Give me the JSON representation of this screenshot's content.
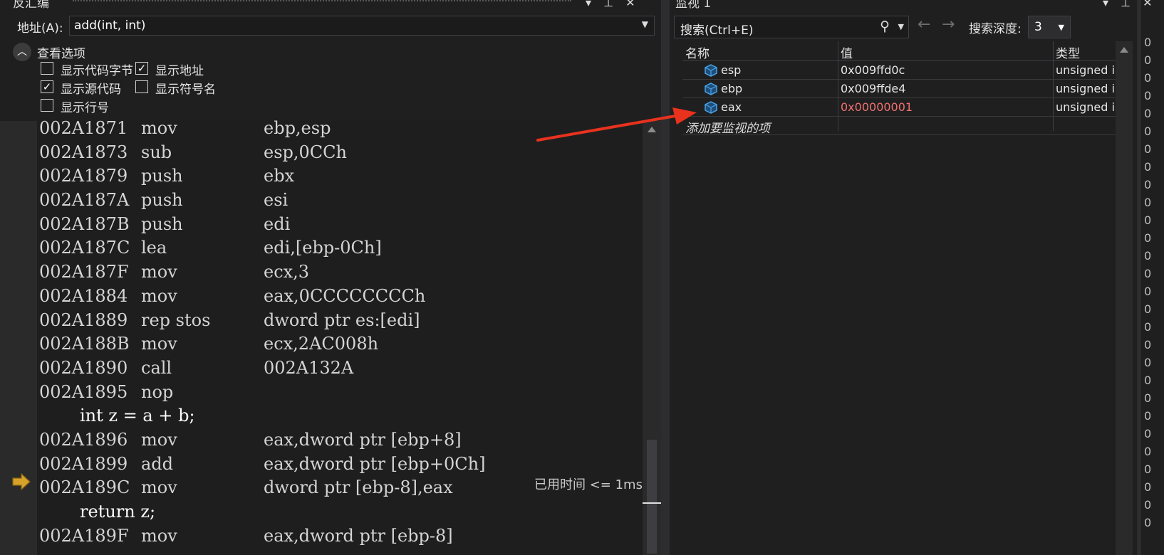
{
  "disasm": {
    "title": "反汇编",
    "title_buttons": [
      "▾",
      "⊥",
      "✕"
    ],
    "address_label": "地址(A):",
    "address_value": "add(int, int)",
    "view_options_label": "查看选项",
    "options": [
      {
        "label": "显示代码字节",
        "checked": false
      },
      {
        "label": "显示地址",
        "checked": true
      },
      {
        "label": "显示源代码",
        "checked": true
      },
      {
        "label": "显示符号名",
        "checked": false
      },
      {
        "label": "显示行号",
        "checked": false
      }
    ],
    "lines": [
      {
        "kind": "asm",
        "addr": "002A1871",
        "op": "mov",
        "args": "ebp,esp"
      },
      {
        "kind": "asm",
        "addr": "002A1873",
        "op": "sub",
        "args": "esp,0CCh"
      },
      {
        "kind": "asm",
        "addr": "002A1879",
        "op": "push",
        "args": "ebx"
      },
      {
        "kind": "asm",
        "addr": "002A187A",
        "op": "push",
        "args": "esi"
      },
      {
        "kind": "asm",
        "addr": "002A187B",
        "op": "push",
        "args": "edi"
      },
      {
        "kind": "asm",
        "addr": "002A187C",
        "op": "lea",
        "args": "edi,[ebp-0Ch]"
      },
      {
        "kind": "asm",
        "addr": "002A187F",
        "op": "mov",
        "args": "ecx,3"
      },
      {
        "kind": "asm",
        "addr": "002A1884",
        "op": "mov",
        "args": "eax,0CCCCCCCCh"
      },
      {
        "kind": "asm",
        "addr": "002A1889",
        "op": "rep stos",
        "args": "dword ptr es:[edi]"
      },
      {
        "kind": "asm",
        "addr": "002A188B",
        "op": "mov",
        "args": "ecx,2AC008h"
      },
      {
        "kind": "asm",
        "addr": "002A1890",
        "op": "call",
        "args": "002A132A"
      },
      {
        "kind": "asm",
        "addr": "002A1895",
        "op": "nop",
        "args": ""
      },
      {
        "kind": "src",
        "text": "int z = a + b;"
      },
      {
        "kind": "asm",
        "addr": "002A1896",
        "op": "mov",
        "args": "eax,dword ptr [ebp+8]"
      },
      {
        "kind": "asm",
        "addr": "002A1899",
        "op": "add",
        "args": "eax,dword ptr [ebp+0Ch]"
      },
      {
        "kind": "asm",
        "addr": "002A189C",
        "op": "mov",
        "args": "dword ptr [ebp-8],eax"
      },
      {
        "kind": "src",
        "text": "return z;"
      },
      {
        "kind": "asm",
        "addr": "002A189F",
        "op": "mov",
        "args": "eax,dword ptr [ebp-8]"
      }
    ],
    "current_line_index": 14,
    "elapsed_text": "已用时间 <= 1ms",
    "icons": {
      "current_instruction": "instruction-pointer-arrow-icon",
      "collapse": "chevron-up-icon"
    },
    "colors": {
      "instruction_pointer": "#d6a22a"
    }
  },
  "watch": {
    "title": "监视 1",
    "search_placeholder": "搜索(Ctrl+E)",
    "depth_label": "搜索深度:",
    "depth_value": "3",
    "columns": [
      "名称",
      "值",
      "类型"
    ],
    "rows": [
      {
        "name": "esp",
        "value": "0x009ffd0c",
        "type": "unsigned int",
        "changed": false
      },
      {
        "name": "ebp",
        "value": "0x009ffde4",
        "type": "unsigned int",
        "changed": false
      },
      {
        "name": "eax",
        "value": "0x00000001",
        "type": "unsigned int",
        "changed": true
      }
    ],
    "add_item_text": "添加要监视的项",
    "colors": {
      "changed_value": "#f07070",
      "annotation_arrow": "#e8321e"
    }
  },
  "edge_column": [
    "0",
    "0",
    "0",
    "0",
    "0",
    "0",
    "0",
    "0",
    "0",
    "0",
    "0",
    "0",
    "0",
    "0",
    "0",
    "0",
    "0",
    "0",
    "0",
    "0",
    "0",
    "0",
    "0",
    "0",
    "0",
    "0",
    "0",
    "0"
  ]
}
